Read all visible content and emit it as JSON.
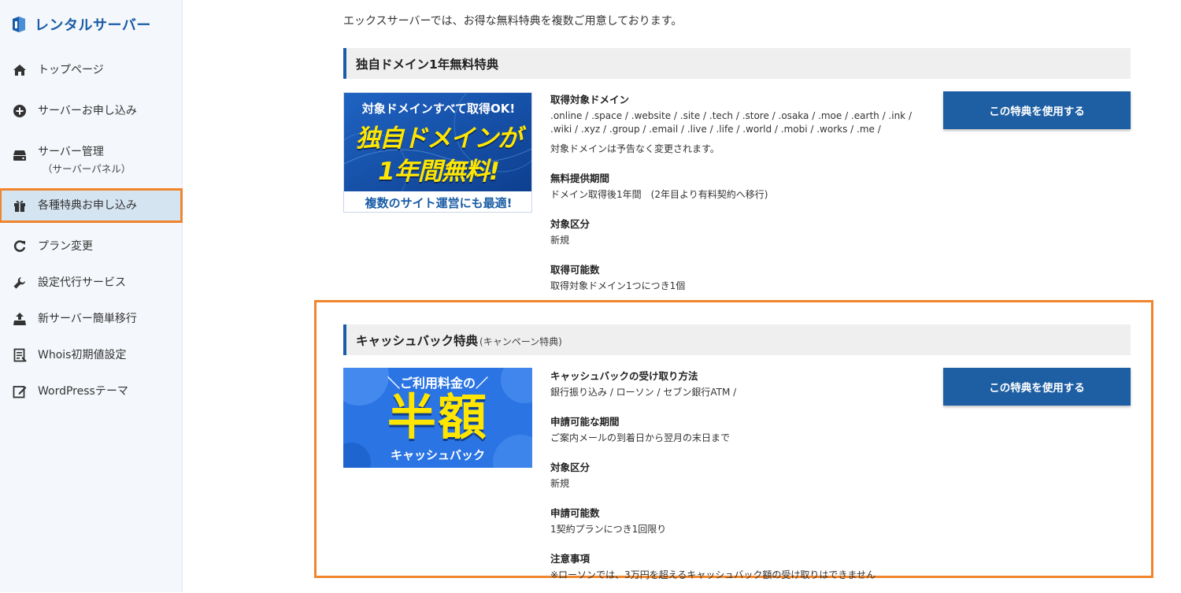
{
  "sidebar": {
    "brand": "レンタルサーバー",
    "items": [
      {
        "label": "トップページ",
        "icon": "home-icon"
      },
      {
        "label": "サーバーお申し込み",
        "icon": "plus-circle-icon"
      },
      {
        "label": "サーバー管理",
        "sub": "（サーバーパネル）",
        "icon": "server-icon"
      },
      {
        "label": "各種特典お申し込み",
        "icon": "gift-icon",
        "active": true
      },
      {
        "label": "プラン変更",
        "icon": "refresh-icon"
      },
      {
        "label": "設定代行サービス",
        "icon": "wrench-icon"
      },
      {
        "label": "新サーバー簡単移行",
        "icon": "upload-icon"
      },
      {
        "label": "Whois初期値設定",
        "icon": "document-list-icon"
      },
      {
        "label": "WordPressテーマ",
        "icon": "edit-square-icon"
      }
    ]
  },
  "main": {
    "intro": "エックスサーバーでは、お得な無料特典を複数ご用意しております。",
    "domain_offer": {
      "title": "独自ドメイン1年無料特典",
      "banner": {
        "top": "対象ドメインすべて取得OK!",
        "line1": "独自ドメインが",
        "line2": "1年間無料!",
        "bottom": "複数のサイト運営にも最適!"
      },
      "fields": [
        {
          "title": "取得対象ドメイン",
          "value": ".online / .space / .website / .site / .tech / .store / .osaka / .moe / .earth / .ink / .wiki / .xyz / .group / .email / .live / .life / .world / .mobi / .works / .me /",
          "note": "対象ドメインは予告なく変更されます。"
        },
        {
          "title": "無料提供期間",
          "value": "ドメイン取得後1年間　(2年目より有料契約へ移行)"
        },
        {
          "title": "対象区分",
          "value": "新規"
        },
        {
          "title": "取得可能数",
          "value": "取得対象ドメイン1つにつき1個"
        }
      ],
      "button": "この特典を使用する"
    },
    "cashback_offer": {
      "title": "キャッシュバック特典",
      "subtitle": "(キャンペーン特典)",
      "banner": {
        "top": "ご利用料金の",
        "main": "半額",
        "bottom": "キャッシュバック"
      },
      "fields": [
        {
          "title": "キャッシュバックの受け取り方法",
          "value": "銀行振り込み / ローソン / セブン銀行ATM /"
        },
        {
          "title": "申請可能な期間",
          "value": "ご案内メールの到着日から翌月の末日まで"
        },
        {
          "title": "対象区分",
          "value": "新規"
        },
        {
          "title": "申請可能数",
          "value": "1契約プランにつき1回限り"
        },
        {
          "title": "注意事項",
          "value": "※ローソンでは、3万円を超えるキャッシュバック額の受け取りはできません"
        }
      ],
      "button": "この特典を使用する"
    }
  },
  "colors": {
    "accent": "#1a5da6",
    "button": "#1e5fa3",
    "highlight": "#f0852d",
    "banner_yellow": "#ffe600"
  }
}
